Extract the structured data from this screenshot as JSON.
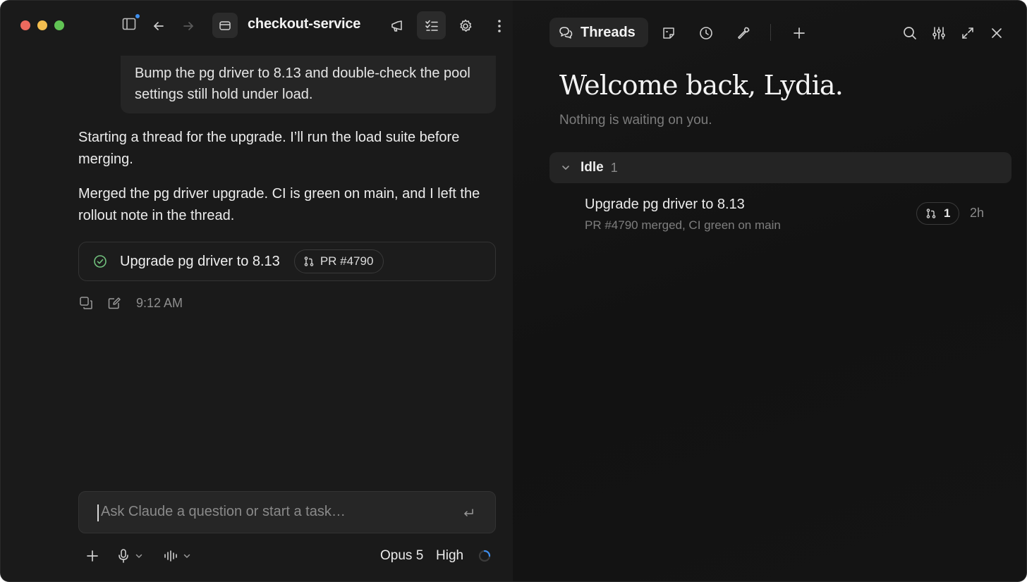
{
  "header": {
    "project_name": "checkout-service"
  },
  "conversation": {
    "user_message": "Bump the pg driver to 8.13 and double-check the pool settings still hold under load.",
    "assistant_messages": [
      "Starting a thread for the upgrade. I’ll run the load suite before merging.",
      "Merged the pg driver upgrade. CI is green on main, and I left the rollout note in the thread."
    ],
    "task_card": {
      "title": "Upgrade pg driver to 8.13",
      "pr_label": "PR #4790",
      "status_color": "#72c27e"
    },
    "timestamp": "9:12 AM"
  },
  "composer": {
    "placeholder": "Ask Claude a question or start a task…",
    "model": "Opus 5",
    "effort": "High"
  },
  "threads_panel": {
    "tab_label": "Threads",
    "welcome": "Welcome back, Lydia.",
    "subtitle": "Nothing is waiting on you.",
    "group": {
      "name": "Idle",
      "count": "1"
    },
    "threads": [
      {
        "title": "Upgrade pg driver to 8.13",
        "subtitle": "PR #4790 merged, CI green on main",
        "pr_count": "1",
        "age": "2h"
      }
    ]
  },
  "colors": {
    "traffic_red": "#ed6a5e",
    "traffic_yellow": "#f4be4f",
    "traffic_green": "#61c454",
    "notification_dot": "#3e8eed",
    "spinner": "#3e8eed"
  }
}
